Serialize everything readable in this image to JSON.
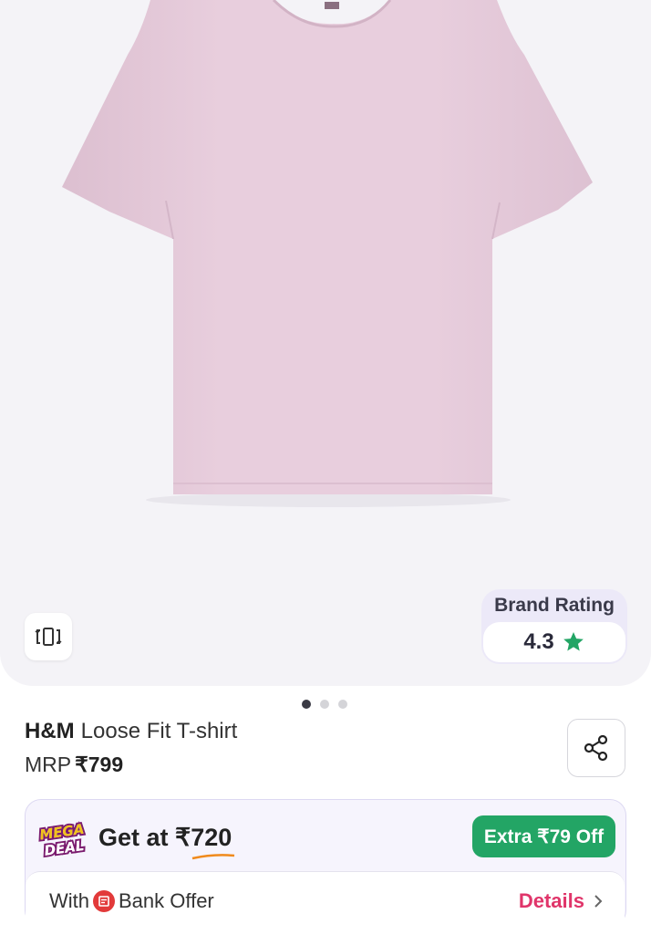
{
  "product": {
    "brand": "H&M",
    "name": "Loose Fit T-shirt",
    "mrp_label": "MRP",
    "mrp_price": "₹799",
    "image_count": 3,
    "active_image": 0
  },
  "brand_rating": {
    "title": "Brand Rating",
    "value": "4.3",
    "star_color": "#23a565"
  },
  "offer": {
    "badge_line1": "MEGA",
    "badge_line2": "DEAL",
    "get_at_label": "Get at",
    "get_at_price": "₹720",
    "extra_off": "Extra ₹79 Off",
    "bank_with": "With",
    "bank_offer": "Bank Offer",
    "details_label": "Details"
  },
  "colors": {
    "shirt": "#e6cbdb",
    "accent_green": "#23a565",
    "accent_pink": "#e0356a"
  },
  "icons": {
    "rotate": "rotate-360-icon",
    "share": "share-icon",
    "star": "star-icon",
    "chevron": "chevron-right-icon",
    "bank": "bank-icon"
  }
}
